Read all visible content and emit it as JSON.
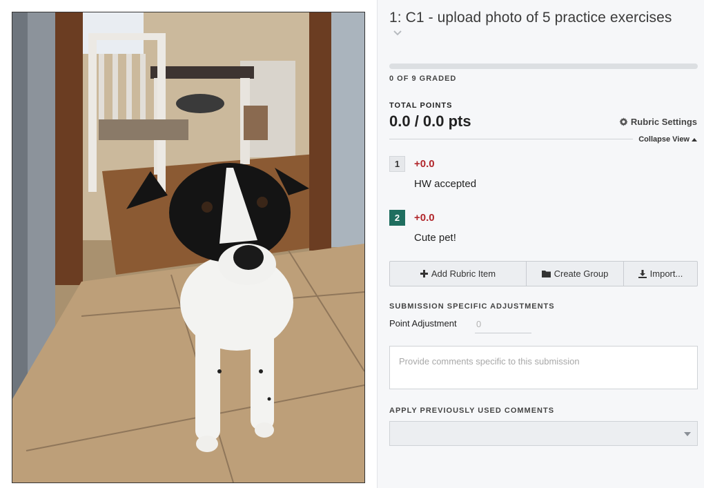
{
  "question": {
    "title": "1: C1 - upload photo of 5 practice exercises"
  },
  "progress": {
    "graded_text": "0 OF 9 GRADED",
    "fraction": 0.0
  },
  "points": {
    "label": "TOTAL POINTS",
    "value": "0.0 / 0.0 pts"
  },
  "rubric_settings": {
    "label": "Rubric Settings",
    "icon": "gear-icon"
  },
  "collapse": {
    "label": "Collapse View"
  },
  "rubric_items": [
    {
      "key": "1",
      "points": "+0.0",
      "description": "HW accepted"
    },
    {
      "key": "2",
      "points": "+0.0",
      "description": "Cute pet!"
    }
  ],
  "actions": {
    "add": "Add Rubric Item",
    "group": "Create Group",
    "import": "Import..."
  },
  "adjustments": {
    "label": "SUBMISSION SPECIFIC ADJUSTMENTS",
    "point_label": "Point Adjustment",
    "point_placeholder": "0",
    "comment_placeholder": "Provide comments specific to this submission"
  },
  "previous_comments": {
    "label": "APPLY PREVIOUSLY USED COMMENTS",
    "selected": ""
  },
  "colors": {
    "accent": "#1f6e5f",
    "points_negative": "#b1262b",
    "panel_bg": "#f6f7f9"
  }
}
